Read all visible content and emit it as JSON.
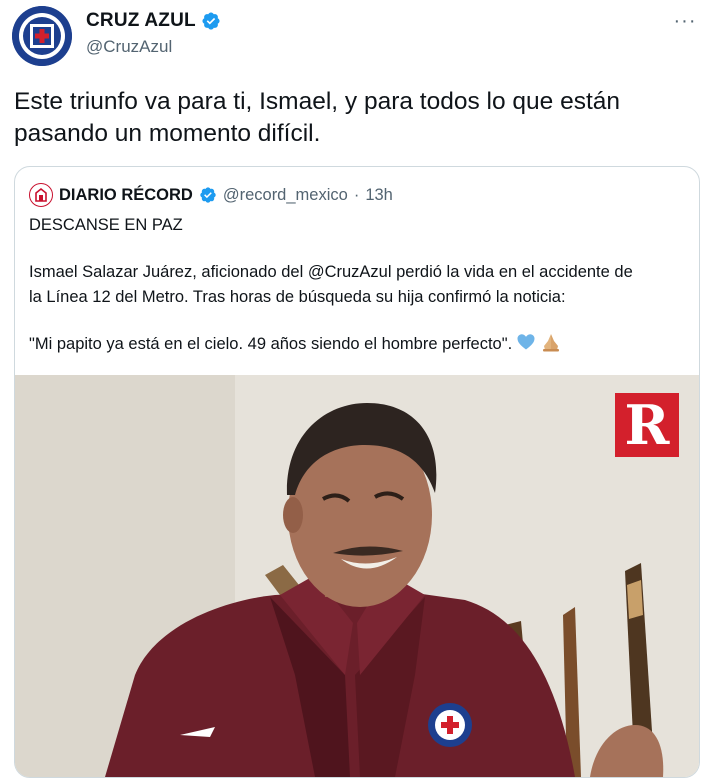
{
  "author": {
    "display_name": "CRUZ AZUL",
    "handle": "@CruzAzul",
    "verified": true,
    "avatar_icon": "cruz-azul-crest-icon"
  },
  "menu": {
    "more_label": "···"
  },
  "tweet": {
    "lines": [
      "Este triunfo va para ti, Ismael, y para todos lo que están",
      "pasando un momento difícil."
    ]
  },
  "quoted": {
    "display_name": "DIARIO RÉCORD",
    "handle": "@record_mexico",
    "separator": "·",
    "time": "13h",
    "verified": true,
    "avatar_icon": "record-logo-icon",
    "headline": "DESCANSE EN PAZ",
    "paragraph_lines": [
      "Ismael Salazar Juárez, aficionado del @CruzAzul perdió la vida en el accidente de",
      "la Línea 12 del Metro. Tras horas de búsqueda su hija confirmó la noticia:"
    ],
    "quote_line": "\"Mi papito ya está en el cielo. 49 años siendo el hombre perfecto\".",
    "emojis": [
      "blue-heart-icon",
      "folded-hands-icon"
    ],
    "photo": {
      "watermark_letter": "R",
      "brand_color": "#d3202c"
    }
  },
  "colors": {
    "text": "#0f1419",
    "muted": "#536471",
    "verified_blue": "#1d9bf0",
    "border": "#cfd9de",
    "jacket": "#6b1f2a"
  }
}
